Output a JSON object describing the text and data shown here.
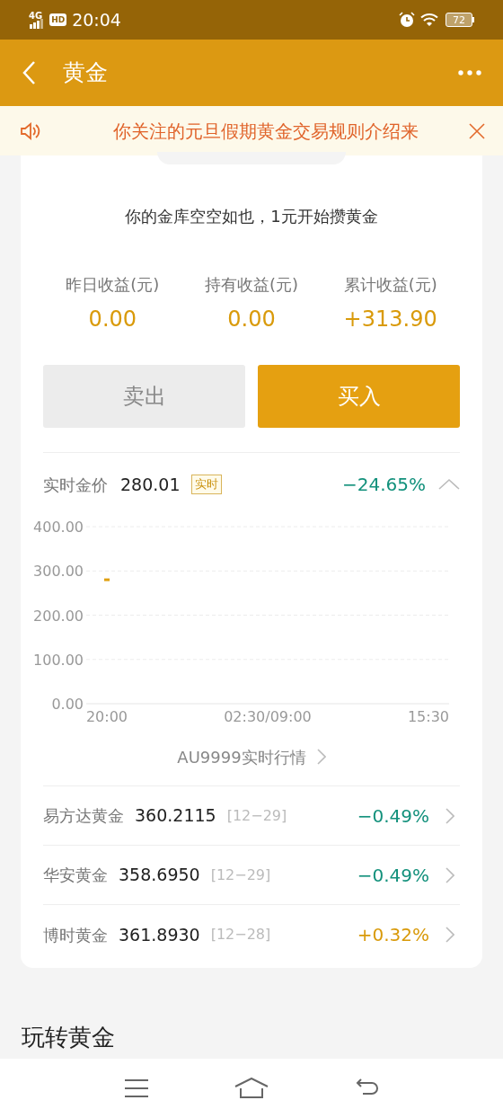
{
  "status_bar": {
    "network": "4G",
    "hd": "HD",
    "time": "20:04",
    "battery": "72"
  },
  "header": {
    "title": "黄金"
  },
  "notice": {
    "text": "你关注的元旦假期黄金交易规则介绍来"
  },
  "vault": {
    "message": "你的金库空空如也，1元开始攒黄金",
    "stats": [
      {
        "label": "昨日收益(元)",
        "value": "0.00"
      },
      {
        "label": "持有收益(元)",
        "value": "0.00"
      },
      {
        "label": "累计收益(元)",
        "value": "+313.90"
      }
    ],
    "buttons": [
      {
        "label": "卖出",
        "kind": "secondary"
      },
      {
        "label": "买入",
        "kind": "primary"
      }
    ]
  },
  "realtime": {
    "label": "实时金价",
    "price": "280.01",
    "badge": "实时",
    "change": "−24.65%",
    "kind": "fall",
    "expanded": true,
    "chart_data": {
      "type": "line",
      "grid": true,
      "categories": [
        "20:00",
        "02:30/09:00",
        "15:30"
      ],
      "series": [
        {
          "color": "#e0a010",
          "marker": "square",
          "values": [
            280,
            null,
            null
          ]
        }
      ],
      "ylim": [
        0,
        400
      ],
      "yticks": [
        {
          "value": 0,
          "label": "0.00"
        },
        {
          "value": 100,
          "label": "100.00"
        },
        {
          "value": 200,
          "label": "200.00"
        },
        {
          "value": 300,
          "label": "300.00"
        },
        {
          "value": 400,
          "label": "400.00"
        }
      ]
    },
    "link": "AU9999实时行情"
  },
  "funds": [
    {
      "name": "易方达黄金",
      "value": "360.2115",
      "date": "[12−29]",
      "change": "−0.49%",
      "kind": "fall"
    },
    {
      "name": "华安黄金",
      "value": "358.6950",
      "date": "[12−29]",
      "change": "−0.49%",
      "kind": "fall"
    },
    {
      "name": "博时黄金",
      "value": "361.8930",
      "date": "[12−28]",
      "change": "+0.32%",
      "kind": "rise"
    }
  ],
  "section_title": "玩转黄金"
}
